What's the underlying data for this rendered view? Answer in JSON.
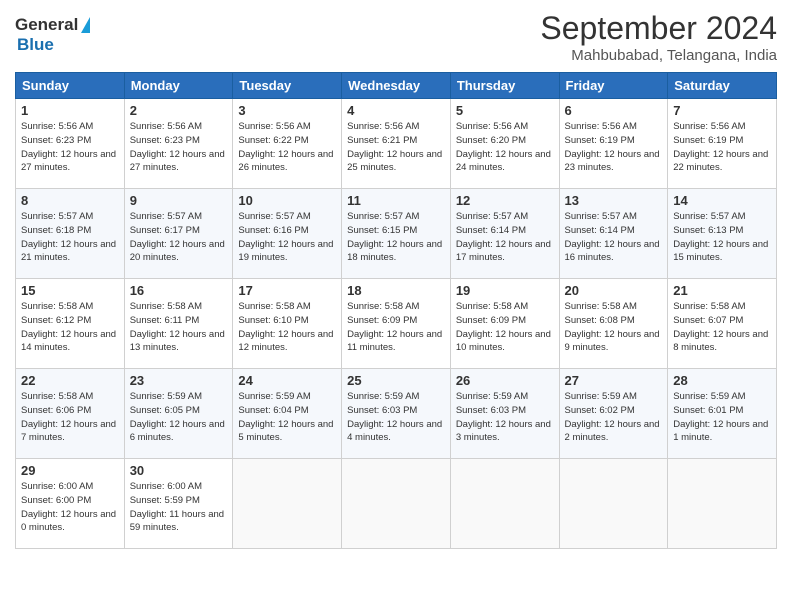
{
  "header": {
    "logo_general": "General",
    "logo_blue": "Blue",
    "month_title": "September 2024",
    "location": "Mahbubabad, Telangana, India"
  },
  "weekdays": [
    "Sunday",
    "Monday",
    "Tuesday",
    "Wednesday",
    "Thursday",
    "Friday",
    "Saturday"
  ],
  "weeks": [
    [
      {
        "day": "1",
        "sunrise": "Sunrise: 5:56 AM",
        "sunset": "Sunset: 6:23 PM",
        "daylight": "Daylight: 12 hours and 27 minutes."
      },
      {
        "day": "2",
        "sunrise": "Sunrise: 5:56 AM",
        "sunset": "Sunset: 6:23 PM",
        "daylight": "Daylight: 12 hours and 27 minutes."
      },
      {
        "day": "3",
        "sunrise": "Sunrise: 5:56 AM",
        "sunset": "Sunset: 6:22 PM",
        "daylight": "Daylight: 12 hours and 26 minutes."
      },
      {
        "day": "4",
        "sunrise": "Sunrise: 5:56 AM",
        "sunset": "Sunset: 6:21 PM",
        "daylight": "Daylight: 12 hours and 25 minutes."
      },
      {
        "day": "5",
        "sunrise": "Sunrise: 5:56 AM",
        "sunset": "Sunset: 6:20 PM",
        "daylight": "Daylight: 12 hours and 24 minutes."
      },
      {
        "day": "6",
        "sunrise": "Sunrise: 5:56 AM",
        "sunset": "Sunset: 6:19 PM",
        "daylight": "Daylight: 12 hours and 23 minutes."
      },
      {
        "day": "7",
        "sunrise": "Sunrise: 5:56 AM",
        "sunset": "Sunset: 6:19 PM",
        "daylight": "Daylight: 12 hours and 22 minutes."
      }
    ],
    [
      {
        "day": "8",
        "sunrise": "Sunrise: 5:57 AM",
        "sunset": "Sunset: 6:18 PM",
        "daylight": "Daylight: 12 hours and 21 minutes."
      },
      {
        "day": "9",
        "sunrise": "Sunrise: 5:57 AM",
        "sunset": "Sunset: 6:17 PM",
        "daylight": "Daylight: 12 hours and 20 minutes."
      },
      {
        "day": "10",
        "sunrise": "Sunrise: 5:57 AM",
        "sunset": "Sunset: 6:16 PM",
        "daylight": "Daylight: 12 hours and 19 minutes."
      },
      {
        "day": "11",
        "sunrise": "Sunrise: 5:57 AM",
        "sunset": "Sunset: 6:15 PM",
        "daylight": "Daylight: 12 hours and 18 minutes."
      },
      {
        "day": "12",
        "sunrise": "Sunrise: 5:57 AM",
        "sunset": "Sunset: 6:14 PM",
        "daylight": "Daylight: 12 hours and 17 minutes."
      },
      {
        "day": "13",
        "sunrise": "Sunrise: 5:57 AM",
        "sunset": "Sunset: 6:14 PM",
        "daylight": "Daylight: 12 hours and 16 minutes."
      },
      {
        "day": "14",
        "sunrise": "Sunrise: 5:57 AM",
        "sunset": "Sunset: 6:13 PM",
        "daylight": "Daylight: 12 hours and 15 minutes."
      }
    ],
    [
      {
        "day": "15",
        "sunrise": "Sunrise: 5:58 AM",
        "sunset": "Sunset: 6:12 PM",
        "daylight": "Daylight: 12 hours and 14 minutes."
      },
      {
        "day": "16",
        "sunrise": "Sunrise: 5:58 AM",
        "sunset": "Sunset: 6:11 PM",
        "daylight": "Daylight: 12 hours and 13 minutes."
      },
      {
        "day": "17",
        "sunrise": "Sunrise: 5:58 AM",
        "sunset": "Sunset: 6:10 PM",
        "daylight": "Daylight: 12 hours and 12 minutes."
      },
      {
        "day": "18",
        "sunrise": "Sunrise: 5:58 AM",
        "sunset": "Sunset: 6:09 PM",
        "daylight": "Daylight: 12 hours and 11 minutes."
      },
      {
        "day": "19",
        "sunrise": "Sunrise: 5:58 AM",
        "sunset": "Sunset: 6:09 PM",
        "daylight": "Daylight: 12 hours and 10 minutes."
      },
      {
        "day": "20",
        "sunrise": "Sunrise: 5:58 AM",
        "sunset": "Sunset: 6:08 PM",
        "daylight": "Daylight: 12 hours and 9 minutes."
      },
      {
        "day": "21",
        "sunrise": "Sunrise: 5:58 AM",
        "sunset": "Sunset: 6:07 PM",
        "daylight": "Daylight: 12 hours and 8 minutes."
      }
    ],
    [
      {
        "day": "22",
        "sunrise": "Sunrise: 5:58 AM",
        "sunset": "Sunset: 6:06 PM",
        "daylight": "Daylight: 12 hours and 7 minutes."
      },
      {
        "day": "23",
        "sunrise": "Sunrise: 5:59 AM",
        "sunset": "Sunset: 6:05 PM",
        "daylight": "Daylight: 12 hours and 6 minutes."
      },
      {
        "day": "24",
        "sunrise": "Sunrise: 5:59 AM",
        "sunset": "Sunset: 6:04 PM",
        "daylight": "Daylight: 12 hours and 5 minutes."
      },
      {
        "day": "25",
        "sunrise": "Sunrise: 5:59 AM",
        "sunset": "Sunset: 6:03 PM",
        "daylight": "Daylight: 12 hours and 4 minutes."
      },
      {
        "day": "26",
        "sunrise": "Sunrise: 5:59 AM",
        "sunset": "Sunset: 6:03 PM",
        "daylight": "Daylight: 12 hours and 3 minutes."
      },
      {
        "day": "27",
        "sunrise": "Sunrise: 5:59 AM",
        "sunset": "Sunset: 6:02 PM",
        "daylight": "Daylight: 12 hours and 2 minutes."
      },
      {
        "day": "28",
        "sunrise": "Sunrise: 5:59 AM",
        "sunset": "Sunset: 6:01 PM",
        "daylight": "Daylight: 12 hours and 1 minute."
      }
    ],
    [
      {
        "day": "29",
        "sunrise": "Sunrise: 6:00 AM",
        "sunset": "Sunset: 6:00 PM",
        "daylight": "Daylight: 12 hours and 0 minutes."
      },
      {
        "day": "30",
        "sunrise": "Sunrise: 6:00 AM",
        "sunset": "Sunset: 5:59 PM",
        "daylight": "Daylight: 11 hours and 59 minutes."
      },
      null,
      null,
      null,
      null,
      null
    ]
  ]
}
